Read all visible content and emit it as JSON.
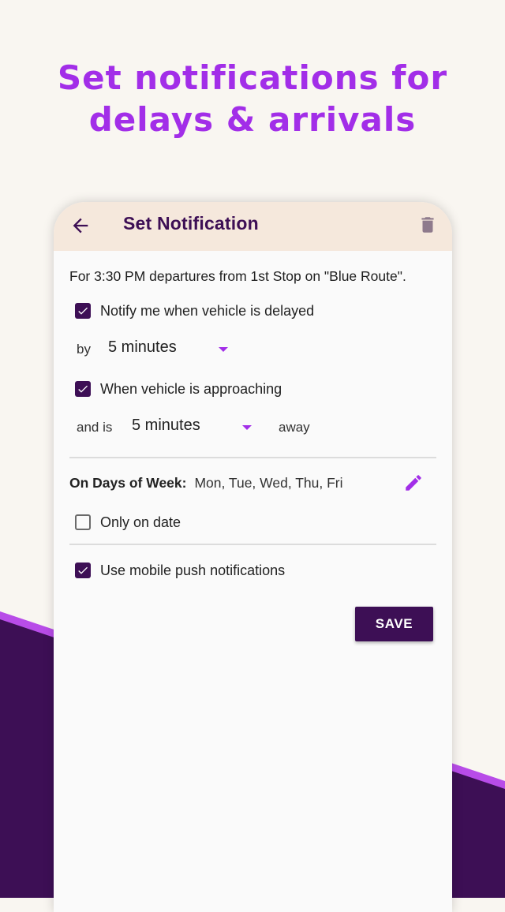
{
  "headline": {
    "line1": "Set notifications for",
    "line2": "delays & arrivals"
  },
  "appbar": {
    "title": "Set Notification",
    "back_icon": "arrow-left-icon",
    "delete_icon": "trash-icon"
  },
  "form": {
    "intro": "For 3:30 PM departures from 1st Stop on \"Blue Route\".",
    "notify_delayed": {
      "label": "Notify me when vehicle is delayed",
      "checked": true
    },
    "delay": {
      "prefix": "by",
      "value": "5 minutes"
    },
    "approaching": {
      "label": "When vehicle is approaching",
      "checked": true
    },
    "away": {
      "prefix": "and is",
      "value": "5 minutes",
      "suffix": "away"
    },
    "days": {
      "label": "On Days of Week:",
      "value": "Mon, Tue, Wed, Thu, Fri",
      "edit_icon": "pencil-icon"
    },
    "only_on_date": {
      "label": "Only on date",
      "checked": false
    },
    "push": {
      "label": "Use mobile push notifications",
      "checked": true
    },
    "save_label": "SAVE"
  },
  "colors": {
    "accent": "#a22ee8",
    "primary_dark": "#3d0f55",
    "appbar": "#f5e8dc",
    "background": "#f9f6f1"
  }
}
